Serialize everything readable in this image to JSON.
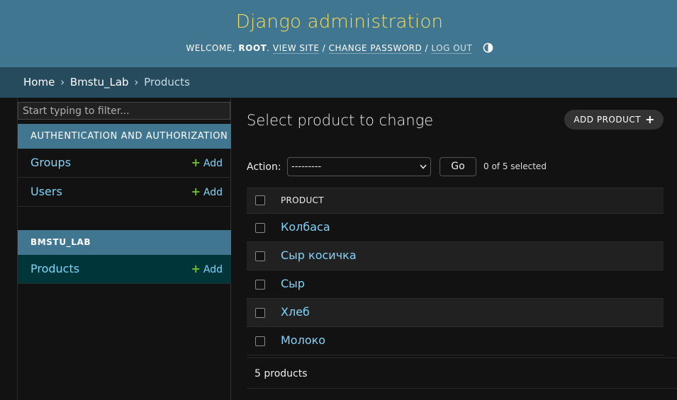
{
  "header": {
    "site_name": "Django administration",
    "welcome": "Welcome, ",
    "username": "root",
    "view_site": "View site",
    "change_password": "Change password",
    "log_out": "Log out",
    "separator": " / "
  },
  "breadcrumbs": {
    "home": "Home",
    "app": "Bmstu_Lab",
    "current": "Products",
    "sep": "›"
  },
  "sidebar": {
    "filter_placeholder": "Start typing to filter...",
    "modules": [
      {
        "caption": "Authentication and Authorization",
        "models": [
          {
            "name": "Groups",
            "add": "Add"
          },
          {
            "name": "Users",
            "add": "Add"
          }
        ]
      },
      {
        "caption": "BMSTU_LAB",
        "models": [
          {
            "name": "Products",
            "add": "Add"
          }
        ]
      }
    ]
  },
  "content": {
    "title": "Select product to change",
    "add_button": "Add product",
    "action_label": "Action:",
    "action_selected": "---------",
    "go_label": "Go",
    "selection_counter": "0 of 5 selected",
    "column_header": "Product",
    "rows": [
      "Колбаса",
      "Сыр косичка",
      "Сыр",
      "Хлеб",
      "Молоко"
    ],
    "paginator": "5 products"
  },
  "colors": {
    "header_bg": "#417690",
    "site_name": "#f5dd5d",
    "breadcrumbs_bg": "#264b5d",
    "link": "#81d4fa",
    "add_plus": "#70bf2b",
    "current_model_bg": "#00363a",
    "page_bg": "#121212"
  },
  "icons": {
    "theme_toggle": "half-circle-contrast-icon",
    "add": "plus-icon",
    "select_caret": "chevron-down-icon"
  }
}
